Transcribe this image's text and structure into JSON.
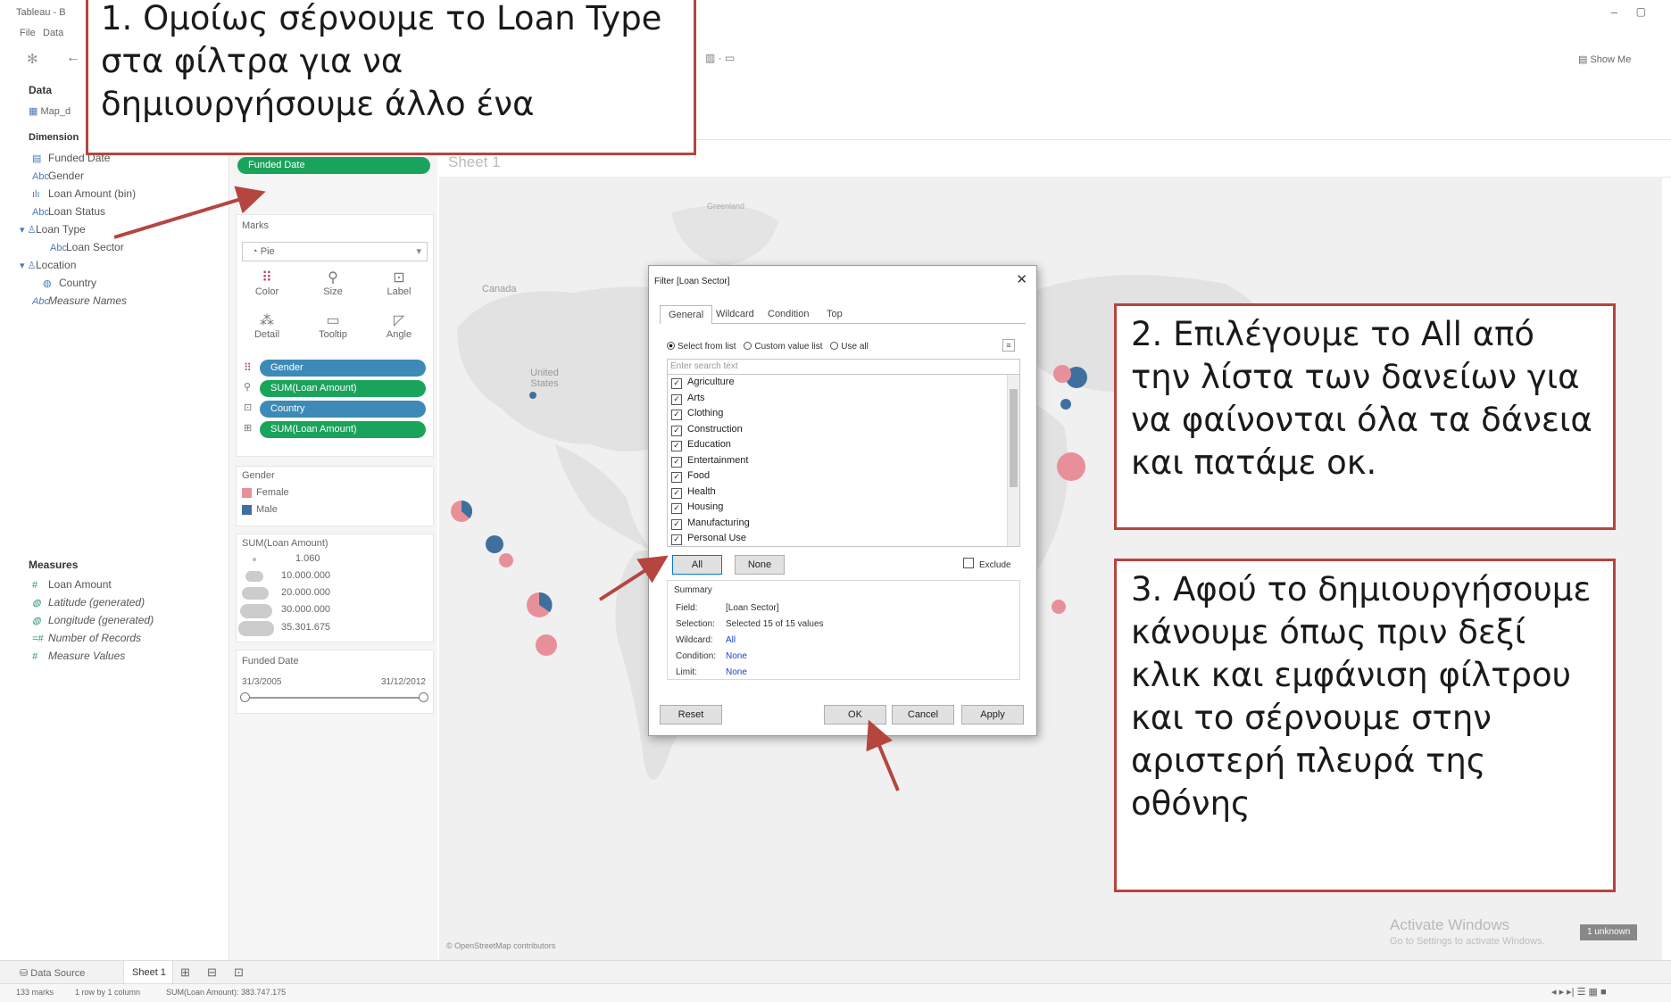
{
  "window": {
    "title": "Tableau - B",
    "menus": [
      "File",
      "Data"
    ]
  },
  "toolbar": {
    "show_me": "Show Me"
  },
  "datapane": {
    "header": "Data",
    "datasource": "Map_d",
    "dimensions_label": "Dimension",
    "dimensions": [
      {
        "label": "Funded Date",
        "icon": "calendar-icon"
      },
      {
        "label": "Gender",
        "icon": "abc-icon"
      },
      {
        "label": "Loan Amount (bin)",
        "icon": "bin-icon"
      },
      {
        "label": "Loan Status",
        "icon": "abc-icon"
      },
      {
        "label": "Loan Type",
        "icon": "hierarchy-icon"
      },
      {
        "label": "Loan Sector",
        "icon": "abc-icon"
      },
      {
        "label": "Location",
        "icon": "hierarchy-icon"
      },
      {
        "label": "Country",
        "icon": "globe-icon"
      },
      {
        "label": "Measure Names",
        "icon": "abc-icon"
      }
    ],
    "measures_label": "Measures",
    "measures": [
      {
        "label": "Loan Amount"
      },
      {
        "label": "Latitude (generated)"
      },
      {
        "label": "Longitude (generated)"
      },
      {
        "label": "Number of Records"
      },
      {
        "label": "Measure Values"
      }
    ]
  },
  "cards": {
    "filter_pill": "Funded Date",
    "marks_title": "Marks",
    "mark_type": "Pie",
    "mark_buttons": [
      "Color",
      "Size",
      "Label",
      "Detail",
      "Tooltip",
      "Angle"
    ],
    "mark_pills": [
      "Gender",
      "SUM(Loan Amount)",
      "Country",
      "SUM(Loan Amount)"
    ],
    "gender_legend": {
      "title": "Gender",
      "items": [
        {
          "label": "Female",
          "color": "#e8909a"
        },
        {
          "label": "Male",
          "color": "#3f6f9f"
        }
      ]
    },
    "size_legend": {
      "title": "SUM(Loan Amount)",
      "items": [
        "1.060",
        "10.000.000",
        "20.000.000",
        "30.000.000",
        "35.301.675"
      ]
    },
    "date_filter": {
      "title": "Funded Date",
      "start": "31/3/2005",
      "end": "31/12/2012"
    }
  },
  "viz": {
    "sheet_title": "Sheet 1",
    "map_labels": [
      "Canada",
      "United States",
      "Greenland"
    ],
    "attribution": "© OpenStreetMap contributors",
    "activate_line1": "Activate Windows",
    "activate_line2": "Go to Settings to activate Windows.",
    "unknown_badge": "1 unknown"
  },
  "dialog": {
    "title": "Filter [Loan Sector]",
    "tabs": [
      "General",
      "Wildcard",
      "Condition",
      "Top"
    ],
    "radio_options": [
      "Select from list",
      "Custom value list",
      "Use all"
    ],
    "search_placeholder": "Enter search text",
    "items": [
      "Agriculture",
      "Arts",
      "Clothing",
      "Construction",
      "Education",
      "Entertainment",
      "Food",
      "Health",
      "Housing",
      "Manufacturing",
      "Personal Use"
    ],
    "all_button": "All",
    "none_button": "None",
    "exclude_label": "Exclude",
    "summary_title": "Summary",
    "summary": [
      {
        "key": "Field:",
        "value": "[Loan Sector]"
      },
      {
        "key": "Selection:",
        "value": "Selected 15 of 15 values"
      },
      {
        "key": "Wildcard:",
        "value": "All"
      },
      {
        "key": "Condition:",
        "value": "None"
      },
      {
        "key": "Limit:",
        "value": "None"
      }
    ],
    "reset": "Reset",
    "ok": "OK",
    "cancel": "Cancel",
    "apply": "Apply"
  },
  "tabbar": {
    "data_source": "Data Source",
    "sheet": "Sheet 1"
  },
  "statusbar": {
    "marks": "133 marks",
    "rows": "1 row by 1 column",
    "sum": "SUM(Loan Amount): 383.747.175"
  },
  "callouts": {
    "one": "1. Ομοίως σέρνουμε το Loan Type στα φίλτρα για να δημιουργήσουμε άλλο ένα",
    "two": "2. Επιλέγουμε το All από την λίστα των δανείων για να φαίνονται όλα τα δάνεια και πατάμε οκ.",
    "three": "3. Αφού το δημιουργήσουμε κάνουμε όπως πριν δεξί κλικ και εμφάνιση φίλτρου και το σέρνουμε στην αριστερή πλευρά της οθόνης"
  },
  "colors": {
    "green_pill": "#1aa35b",
    "blue_pill": "#3d8ab8",
    "callout_border": "#b5453f",
    "arrow": "#b5453f"
  }
}
